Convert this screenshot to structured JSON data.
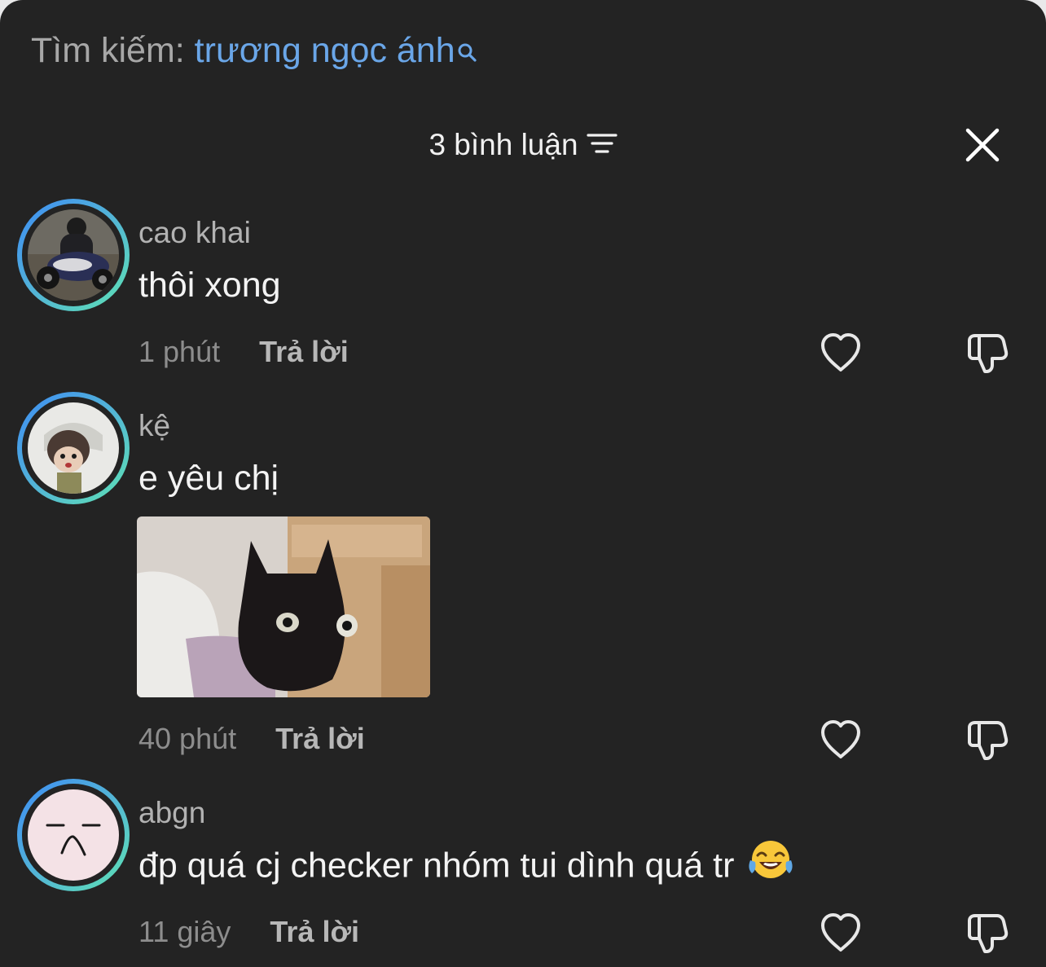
{
  "search": {
    "prefix": "Tìm kiếm:",
    "query": "trương ngọc ánh",
    "icon": "search-icon"
  },
  "header": {
    "title": "3 bình luận",
    "sort_icon": "sort-lines-icon",
    "close_icon": "close-icon"
  },
  "colors": {
    "background": "#232323",
    "link": "#6aa6e8",
    "ring_start": "#3d8cf5",
    "ring_end": "#5ee3b3"
  },
  "comments": [
    {
      "username": "cao khai",
      "text": "thôi xong",
      "time": "1 phút",
      "reply": "Trả lời",
      "avatar": "motorbike-photo-avatar"
    },
    {
      "username": "kệ",
      "text": "e yêu chị",
      "time": "40 phút",
      "reply": "Trả lời",
      "avatar": "doll-face-avatar",
      "attachment": "black-cat-photo"
    },
    {
      "username": "abgn",
      "text": "đp quá cj checker nhóm tui dình quá tr",
      "emoji": "face-with-tears-of-joy",
      "time": "11 giây",
      "reply": "Trả lời",
      "avatar": "drawn-face-avatar"
    }
  ]
}
